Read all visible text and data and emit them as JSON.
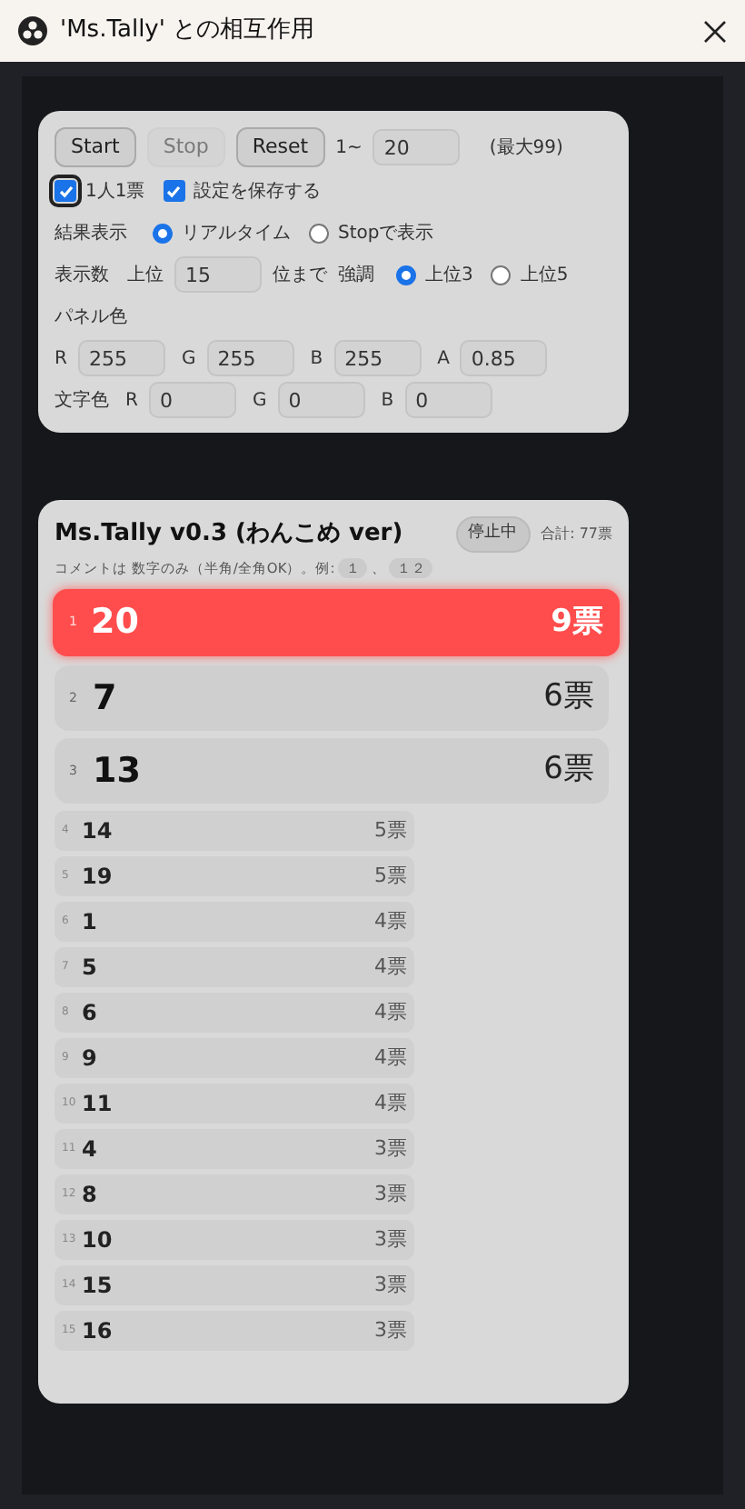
{
  "window": {
    "title": "'Ms.Tally' との相互作用"
  },
  "settings": {
    "buttons": [
      {
        "label": "Start",
        "disabled": false
      },
      {
        "label": "Stop",
        "disabled": true
      },
      {
        "label": "Reset",
        "disabled": false
      }
    ],
    "range_prefix": "1~",
    "range_value": "20",
    "range_note": "(最大99)",
    "checkboxes": [
      {
        "label": "1人1票",
        "checked": true
      },
      {
        "label": "設定を保存する",
        "checked": true
      }
    ],
    "result_display": {
      "label": "結果表示",
      "options": [
        {
          "label": "リアルタイム",
          "selected": true
        },
        {
          "label": "Stopで表示",
          "selected": false
        }
      ]
    },
    "count": {
      "label": "表示数",
      "prefix": "上位",
      "value": "15",
      "suffix": "位まで"
    },
    "emphasis": {
      "label": "強調",
      "options": [
        {
          "label": "上位3",
          "selected": true
        },
        {
          "label": "上位5",
          "selected": false
        }
      ]
    },
    "panel_color": {
      "label": "パネル色",
      "fields": [
        {
          "label": "R",
          "value": "255"
        },
        {
          "label": "G",
          "value": "255"
        },
        {
          "label": "B",
          "value": "255"
        },
        {
          "label": "A",
          "value": "0.85"
        }
      ]
    },
    "text_color": {
      "label": "文字色",
      "fields": [
        {
          "label": "R",
          "value": "0"
        },
        {
          "label": "G",
          "value": "0"
        },
        {
          "label": "B",
          "value": "0"
        }
      ]
    }
  },
  "results": {
    "title": "Ms.Tally v0.3 (わんこめ ver)",
    "status": "停止中",
    "total": "合計: 77票",
    "hint": "コメントは 数字のみ（半角/全角OK）。例:",
    "examples": [
      "１",
      "１２"
    ],
    "example_separator": "、",
    "rows": [
      {
        "rank": "1",
        "label": "20",
        "votes": "9票",
        "kind": "first"
      },
      {
        "rank": "2",
        "label": "7",
        "votes": "6票",
        "kind": "top"
      },
      {
        "rank": "3",
        "label": "13",
        "votes": "6票",
        "kind": "top"
      },
      {
        "rank": "4",
        "label": "14",
        "votes": "5票",
        "kind": "normal"
      },
      {
        "rank": "5",
        "label": "19",
        "votes": "5票",
        "kind": "normal"
      },
      {
        "rank": "6",
        "label": "1",
        "votes": "4票",
        "kind": "normal"
      },
      {
        "rank": "7",
        "label": "5",
        "votes": "4票",
        "kind": "normal"
      },
      {
        "rank": "8",
        "label": "6",
        "votes": "4票",
        "kind": "normal"
      },
      {
        "rank": "9",
        "label": "9",
        "votes": "4票",
        "kind": "normal"
      },
      {
        "rank": "10",
        "label": "11",
        "votes": "4票",
        "kind": "normal"
      },
      {
        "rank": "11",
        "label": "4",
        "votes": "3票",
        "kind": "normal"
      },
      {
        "rank": "12",
        "label": "8",
        "votes": "3票",
        "kind": "normal"
      },
      {
        "rank": "13",
        "label": "10",
        "votes": "3票",
        "kind": "normal"
      },
      {
        "rank": "14",
        "label": "15",
        "votes": "3票",
        "kind": "normal"
      },
      {
        "rank": "15",
        "label": "16",
        "votes": "3票",
        "kind": "normal"
      }
    ]
  }
}
